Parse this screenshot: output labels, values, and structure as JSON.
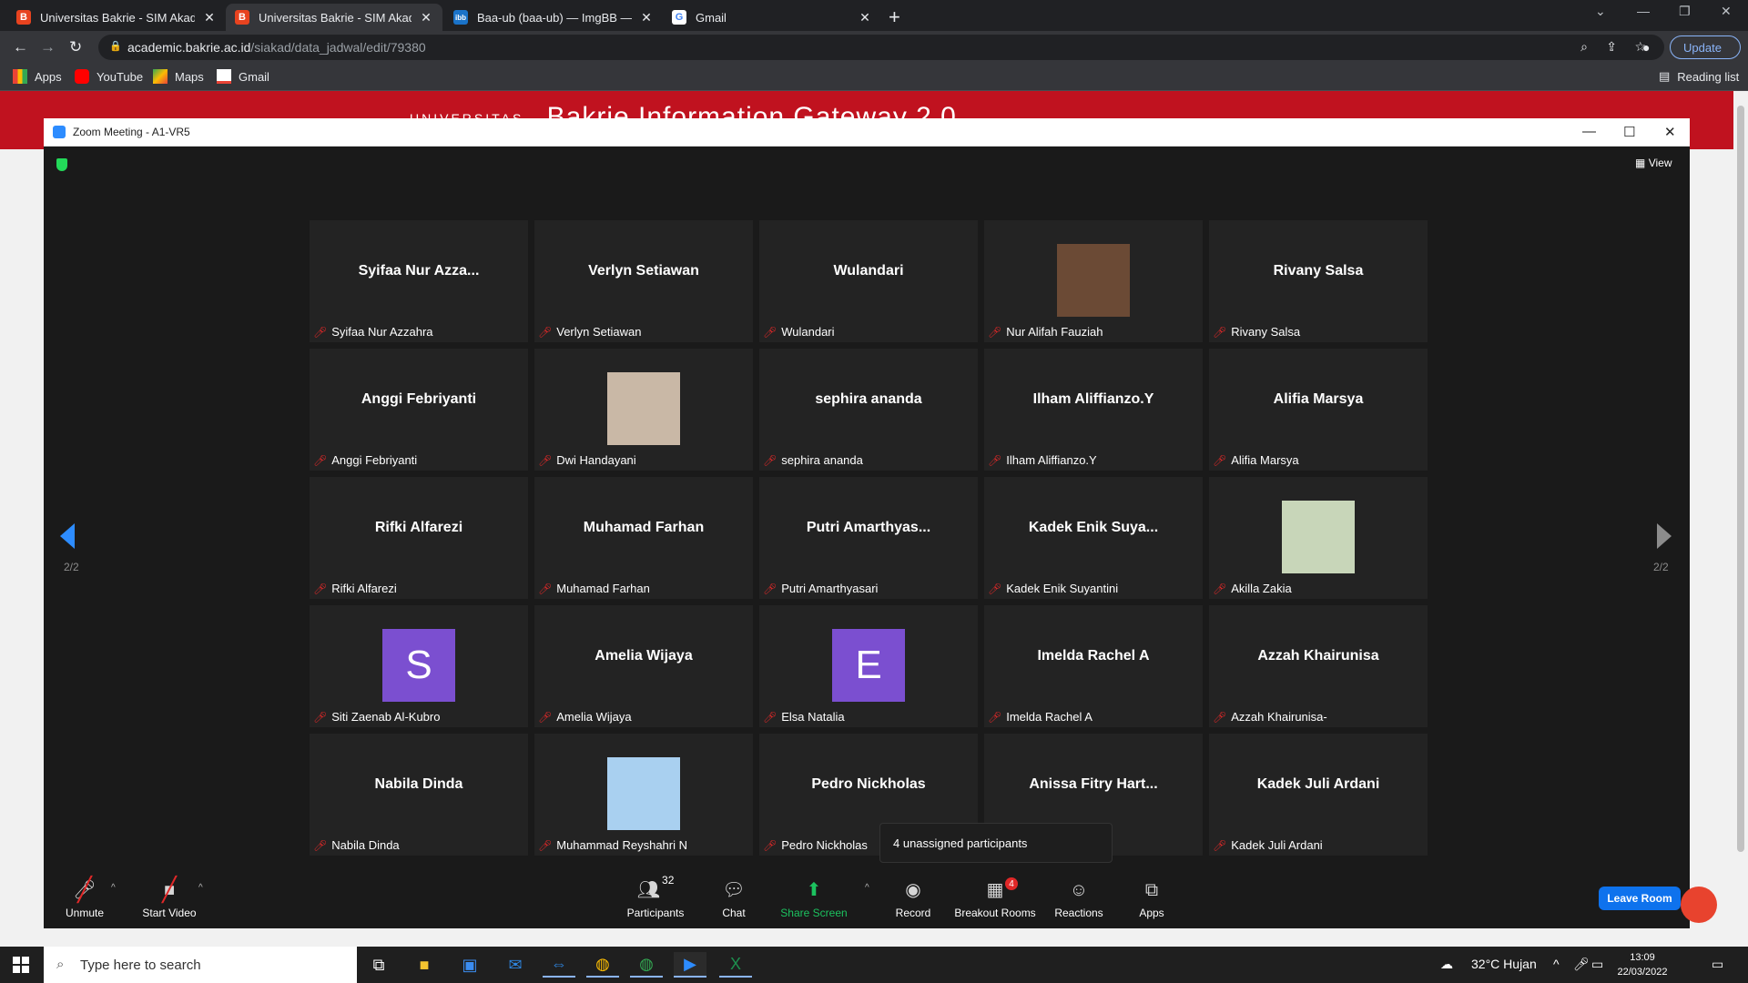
{
  "browser": {
    "tabs": [
      {
        "title": "Universitas Bakrie - SIM Akadem",
        "favicon": "B",
        "active": false
      },
      {
        "title": "Universitas Bakrie - SIM Akadem",
        "favicon": "B",
        "active": true
      },
      {
        "title": "Baa-ub (baa-ub) — ImgBB — La",
        "favicon": "ibb",
        "active": false
      },
      {
        "title": "Gmail",
        "favicon": "G",
        "active": false
      }
    ],
    "address": {
      "host": "academic.bakrie.ac.id",
      "path": "/siakad/data_jadwal/edit/79380"
    },
    "update_label": "Update",
    "bookmarks": [
      {
        "label": "Apps"
      },
      {
        "label": "YouTube"
      },
      {
        "label": "Maps"
      },
      {
        "label": "Gmail"
      }
    ],
    "reading_list": "Reading list"
  },
  "page": {
    "logo_text": "UNIVERSITAS",
    "brand_title": "Bakrie Information Gateway 2.0"
  },
  "zoom": {
    "window_title": "Zoom Meeting - A1-VR5",
    "view_label": "View",
    "page_indicator": "2/2",
    "popup_text": "4 unassigned participants",
    "participants": [
      {
        "display": "Syifaa Nur Azza...",
        "label": "Syifaa Nur Azzahra",
        "kind": "name"
      },
      {
        "display": "Verlyn Setiawan",
        "label": "Verlyn Setiawan",
        "kind": "name"
      },
      {
        "display": "Wulandari",
        "label": "Wulandari",
        "kind": "name"
      },
      {
        "display": "",
        "label": "Nur Alifah Fauziah",
        "kind": "photo",
        "color": "#6b4a35"
      },
      {
        "display": "Rivany Salsa",
        "label": "Rivany Salsa",
        "kind": "name"
      },
      {
        "display": "Anggi Febriyanti",
        "label": "Anggi Febriyanti",
        "kind": "name"
      },
      {
        "display": "",
        "label": "Dwi Handayani",
        "kind": "photo",
        "color": "#c9b8a6"
      },
      {
        "display": "sephira ananda",
        "label": "sephira ananda",
        "kind": "name"
      },
      {
        "display": "Ilham Aliffianzo.Y",
        "label": "Ilham Aliffianzo.Y",
        "kind": "name"
      },
      {
        "display": "Alifia Marsya",
        "label": "Alifia Marsya",
        "kind": "name"
      },
      {
        "display": "Rifki Alfarezi",
        "label": "Rifki Alfarezi",
        "kind": "name"
      },
      {
        "display": "Muhamad Farhan",
        "label": "Muhamad Farhan",
        "kind": "name"
      },
      {
        "display": "Putri Amarthyas...",
        "label": "Putri Amarthyasari",
        "kind": "name"
      },
      {
        "display": "Kadek Enik Suya...",
        "label": "Kadek Enik Suyantini",
        "kind": "name"
      },
      {
        "display": "",
        "label": "Akilla Zakia",
        "kind": "photo",
        "color": "#c8d6b9"
      },
      {
        "display": "S",
        "label": "Siti Zaenab Al-Kubro",
        "kind": "letter",
        "color": "#7b4fd0"
      },
      {
        "display": "Amelia Wijaya",
        "label": "Amelia Wijaya",
        "kind": "name"
      },
      {
        "display": "E",
        "label": "Elsa Natalia",
        "kind": "letter",
        "color": "#7b4fd0"
      },
      {
        "display": "Imelda Rachel A",
        "label": "Imelda Rachel A",
        "kind": "name"
      },
      {
        "display": "Azzah Khairunisa",
        "label": "Azzah Khairunisa-",
        "kind": "name"
      },
      {
        "display": "Nabila Dinda",
        "label": "Nabila Dinda",
        "kind": "name"
      },
      {
        "display": "",
        "label": "Muhammad Reyshahri N",
        "kind": "photo",
        "color": "#a9d0f0"
      },
      {
        "display": "Pedro Nickholas",
        "label": "Pedro Nickholas",
        "kind": "name"
      },
      {
        "display": "Anissa Fitry Hart...",
        "label": "",
        "kind": "name"
      },
      {
        "display": "Kadek Juli Ardani",
        "label": "Kadek Juli Ardani",
        "kind": "name"
      }
    ],
    "controls": {
      "unmute": "Unmute",
      "start_video": "Start Video",
      "participants": "Participants",
      "participants_count": "32",
      "chat": "Chat",
      "share_screen": "Share Screen",
      "record": "Record",
      "breakout_rooms": "Breakout Rooms",
      "breakout_badge": "4",
      "reactions": "Reactions",
      "apps": "Apps",
      "leave_room": "Leave Room"
    }
  },
  "taskbar": {
    "search_placeholder": "Type here to search",
    "weather": "32°C  Hujan",
    "time": "13:09",
    "date": "22/03/2022"
  },
  "colors": {
    "zoom_bg": "#1a1a1a",
    "tile_bg": "#232323",
    "muted_red": "#e02828",
    "zoom_blue": "#0e72ed",
    "share_green": "#1cc25f",
    "page_red": "#c0121f"
  }
}
